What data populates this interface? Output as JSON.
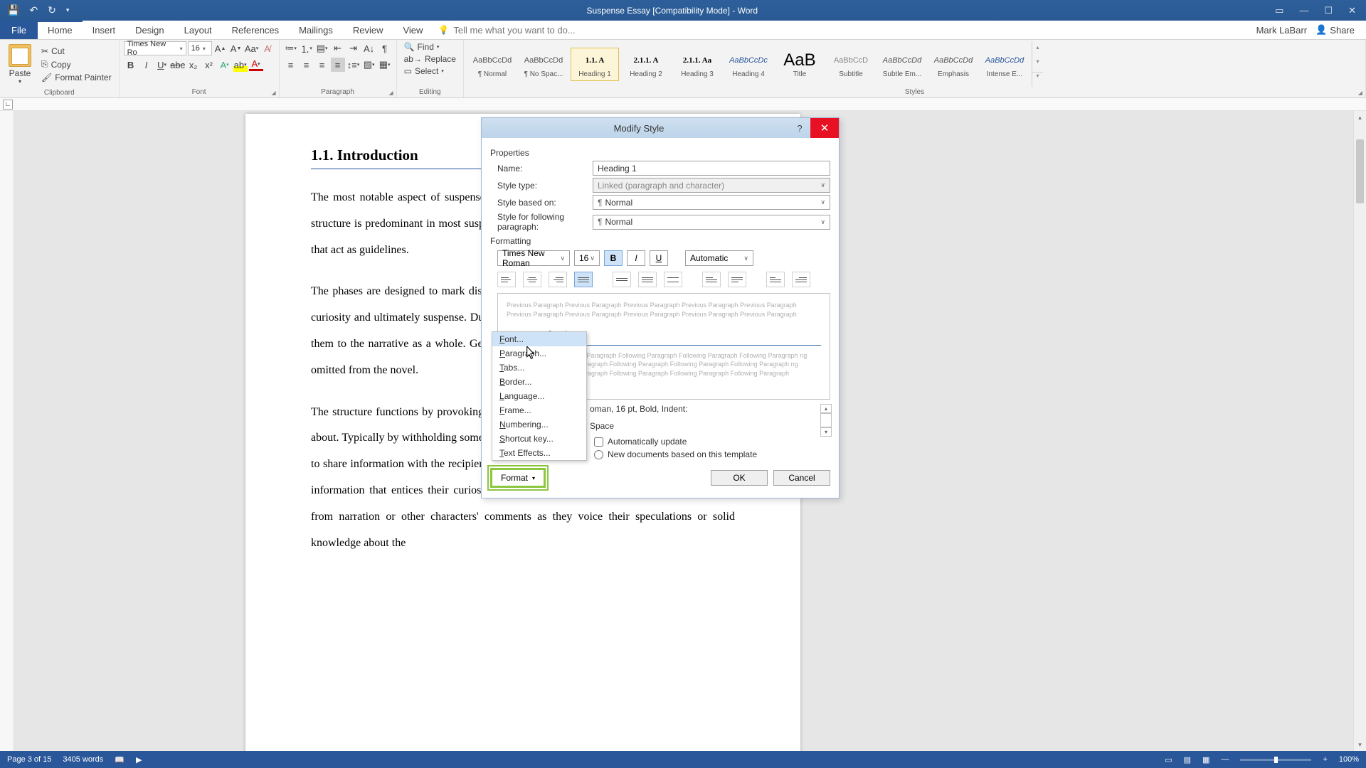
{
  "titlebar": {
    "title": "Suspense Essay [Compatibility Mode] - Word"
  },
  "menu": {
    "file": "File",
    "tabs": [
      "Home",
      "Insert",
      "Design",
      "Layout",
      "References",
      "Mailings",
      "Review",
      "View"
    ],
    "tell_placeholder": "Tell me what you want to do...",
    "user": "Mark LaBarr",
    "share": "Share"
  },
  "ribbon": {
    "clipboard": {
      "label": "Clipboard",
      "paste": "Paste",
      "cut": "Cut",
      "copy": "Copy",
      "painter": "Format Painter"
    },
    "font": {
      "label": "Font",
      "family": "Times New Ro",
      "size": "16"
    },
    "paragraph": {
      "label": "Paragraph"
    },
    "editing": {
      "label": "Editing",
      "find": "Find",
      "replace": "Replace",
      "select": "Select"
    },
    "styles": {
      "label": "Styles",
      "items": [
        {
          "preview": "AaBbCcDd",
          "name": "¶ Normal"
        },
        {
          "preview": "AaBbCcDd",
          "name": "¶ No Spac..."
        },
        {
          "preview": "1.1.  A",
          "name": "Heading 1"
        },
        {
          "preview": "2.1.1.  A",
          "name": "Heading 2"
        },
        {
          "preview": "2.1.1.  Aa",
          "name": "Heading 3"
        },
        {
          "preview": "AaBbCcDc",
          "name": "Heading 4"
        },
        {
          "preview": "AaB",
          "name": "Title"
        },
        {
          "preview": "AaBbCcD",
          "name": "Subtitle"
        },
        {
          "preview": "AaBbCcDd",
          "name": "Subtle Em..."
        },
        {
          "preview": "AaBbCcDd",
          "name": "Emphasis"
        },
        {
          "preview": "AaBbCcDd",
          "name": "Intense E..."
        }
      ]
    }
  },
  "document": {
    "heading": "1.1.   Introduction",
    "p1": "The most notable aspect of suspense in the novel is the curiosity structure. The curiosity structure is predominant in most suspense novels. The structure is composed of four phases that act as guidelines.",
    "p2": "The phases are designed to mark distinct points in the narrative in an effort to bring about curiosity and ultimately suspense. Due to the nature of the phases, the author tends to apply them to the narrative as a whole. Generally the phases are flexible and some may even be omitted from the novel.",
    "p3": "The structure functions by provoking curiosity and then supplying something to be curious about. Typically by withholding some information, the characters within the novel will begin to share information with the recipient. The recipient will start to gather data on the missing information that entices their curiosities. At this stage the information may come simply from narration or other characters' comments as they voice their speculations or solid knowledge about the"
  },
  "dialog": {
    "title": "Modify Style",
    "sections": {
      "properties": "Properties",
      "formatting": "Formatting"
    },
    "props": {
      "name_label": "Name:",
      "name_value": "Heading 1",
      "styletype_label": "Style type:",
      "styletype_value": "Linked (paragraph and character)",
      "basedon_label": "Style based on:",
      "basedon_value": "Normal",
      "following_label": "Style for following paragraph:",
      "following_value": "Normal"
    },
    "formatting": {
      "font": "Times New Roman",
      "size": "16",
      "color": "Automatic"
    },
    "preview": {
      "before": "Previous Paragraph Previous Paragraph Previous Paragraph Previous Paragraph Previous Paragraph Previous Paragraph Previous Paragraph Previous Paragraph Previous Paragraph Previous Paragraph",
      "heading": "1.1.   Introduction",
      "after": "ng Paragraph Following Paragraph Following Paragraph Following Paragraph ng Paragraph Following Paragraph Following Paragraph Following Paragraph ng Paragraph Following Paragraph Following Paragraph Following Paragraph"
    },
    "desc_line1": "oman, 16 pt, Bold, Indent:",
    "desc_line2": "Space",
    "auto_update": "Automatically update",
    "radio_template": "New documents based on this template",
    "format_menu": [
      "Font...",
      "Paragraph...",
      "Tabs...",
      "Border...",
      "Language...",
      "Frame...",
      "Numbering...",
      "Shortcut key...",
      "Text Effects..."
    ],
    "format_btn": "Format",
    "ok": "OK",
    "cancel": "Cancel"
  },
  "statusbar": {
    "page": "Page 3 of 15",
    "words": "3405 words",
    "zoom": "100%"
  }
}
